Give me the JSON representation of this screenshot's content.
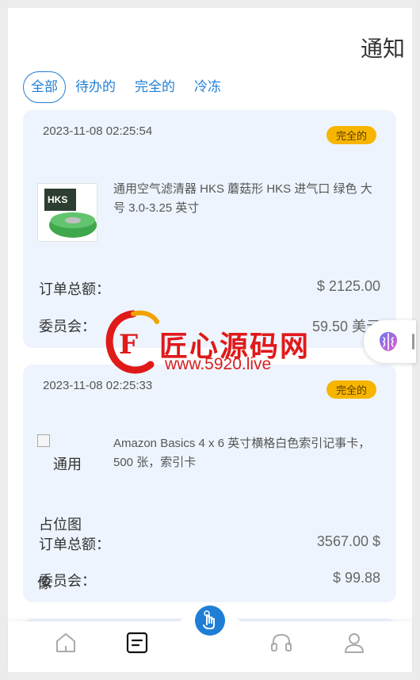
{
  "header": {
    "title": "通知"
  },
  "tabs": [
    {
      "label": "全部",
      "active": true
    },
    {
      "label": "待办的",
      "active": false
    },
    {
      "label": "完全的",
      "active": false
    },
    {
      "label": "冷冻",
      "active": false
    }
  ],
  "orders": [
    {
      "date": "2023-11-08 02:25:54",
      "status": "完全的",
      "product_name": "通用空气滤清器 HKS 蘑菇形 HKS 进气口 绿色 大号 3.0-3.25 英寸",
      "image_label": "HKS",
      "total_label": "订单总额：",
      "total_value": "$ 2125.00",
      "commission_label": "委员会：",
      "commission_value": "59.50 美元"
    },
    {
      "date": "2023-11-08 02:25:33",
      "status": "完全的",
      "product_name": "Amazon Basics 4 x 6 英寸横格白色索引记事卡，500 张，索引卡",
      "image_alt_line1": "通用",
      "image_alt_line2": "占位图",
      "image_alt_line3": "像",
      "total_label": "订单总额：",
      "total_value": "3567.00 $",
      "commission_label": "委员会：",
      "commission_value": "$ 99.88"
    }
  ],
  "watermark": {
    "text": "匠心源码网",
    "url": "www.5920.live"
  },
  "bottom_nav": [
    {
      "icon": "home-icon",
      "active": false
    },
    {
      "icon": "orders-icon",
      "active": true
    },
    {
      "icon": "touch-icon",
      "active": false
    },
    {
      "icon": "headset-icon",
      "active": false
    },
    {
      "icon": "user-icon",
      "active": false
    }
  ],
  "colors": {
    "accent": "#1f7ed6",
    "badge": "#f7b500",
    "card": "#eef4fd"
  }
}
